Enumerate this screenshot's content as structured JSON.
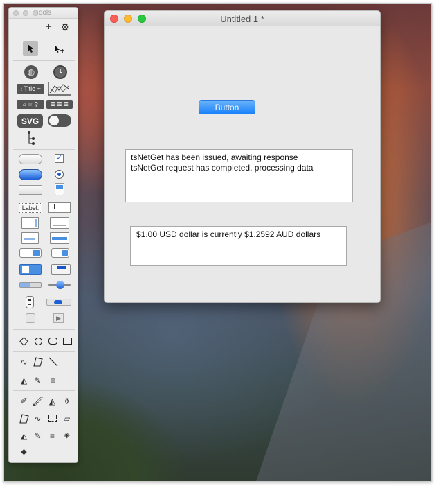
{
  "palette": {
    "title": "Tools",
    "label_tool": "Label:",
    "title_tool": "Title",
    "svg_tool": "SVG"
  },
  "window": {
    "title": "Untitled 1 *",
    "button_label": "Button",
    "log_field": {
      "lines": [
        "tsNetGet has been issued, awaiting response",
        "tsNetGet request has completed, processing data"
      ]
    },
    "result_field": {
      "text": "$1.00 USD dollar is currently $1.2592 AUD dollars"
    }
  },
  "colors": {
    "button_blue": "#1a82fb",
    "close": "#fc5f57",
    "minimize": "#fdbc2e",
    "maximize": "#28c840"
  }
}
